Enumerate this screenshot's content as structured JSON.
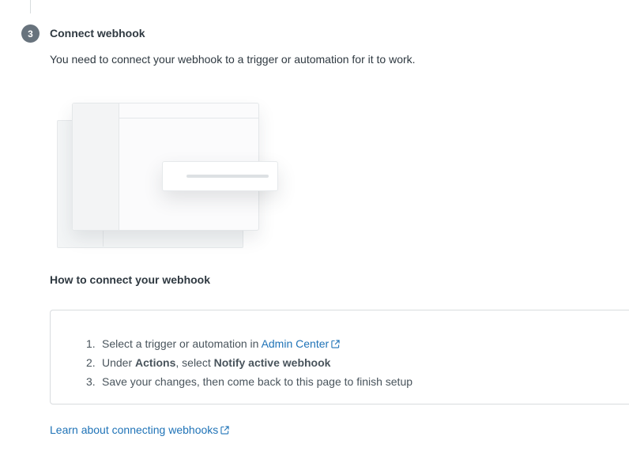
{
  "step": {
    "number": "3",
    "title": "Connect webhook",
    "description": "You need to connect your webhook to a trigger or automation for it to work."
  },
  "howto": {
    "title": "How to connect your webhook",
    "items": [
      {
        "number": "1.",
        "text_before": "Select a trigger or automation in ",
        "link_label": "Admin Center"
      },
      {
        "number": "2.",
        "part1": "Under ",
        "bold1": "Actions",
        "part2": ", select ",
        "bold2": "Notify active webhook"
      },
      {
        "number": "3.",
        "text": "Save your changes, then come back to this page to finish setup"
      }
    ]
  },
  "learn_link": "Learn about connecting webhooks",
  "colors": {
    "link": "#1f73b7",
    "badge": "#68737d",
    "text": "#2f3941"
  },
  "icons": [
    "external-link-icon"
  ]
}
